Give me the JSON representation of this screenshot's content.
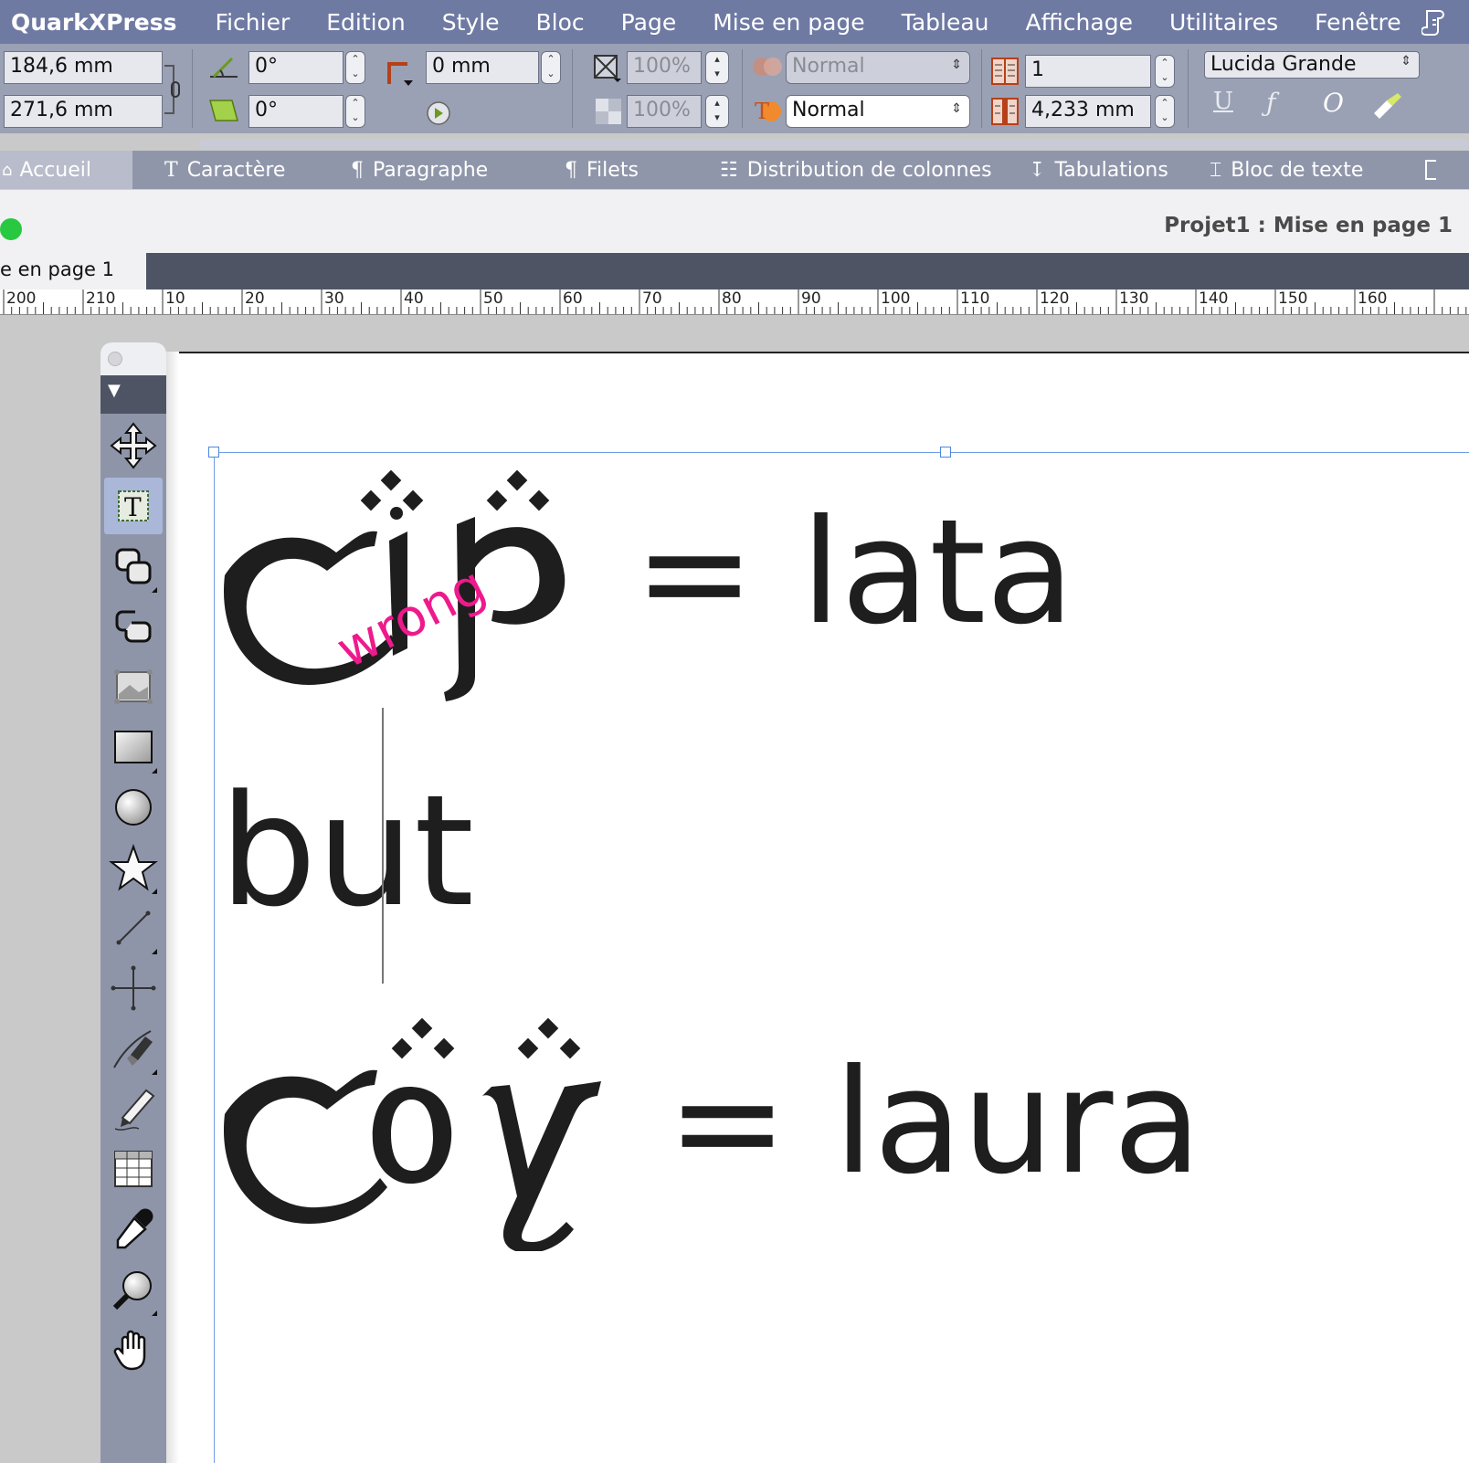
{
  "menubar": {
    "app_name": "QuarkXPress",
    "items": [
      "Fichier",
      "Edition",
      "Style",
      "Bloc",
      "Page",
      "Mise en page",
      "Tableau",
      "Affichage",
      "Utilitaires",
      "Fenêtre"
    ]
  },
  "measurements": {
    "width": "184,6 mm",
    "height": "271,6 mm",
    "angle": "0°",
    "skew": "0°",
    "corner_radius": "0 mm",
    "scale_x": "100%",
    "scale_y": "100%",
    "blend_mode_dim": "Normal",
    "blend_mode": "Normal",
    "columns": "1",
    "gutter": "4,233 mm",
    "font": "Lucida Grande"
  },
  "tabs": [
    "Accueil",
    "Caractère",
    "Paragraphe",
    "Filets",
    "Distribution de colonnes",
    "Tabulations",
    "Bloc de texte"
  ],
  "window": {
    "title": "Projet1 : Mise en page 1",
    "layout_tab": "e en page 1"
  },
  "ruler": {
    "labels": [
      "200",
      "210",
      "10",
      "20",
      "30",
      "40",
      "50",
      "60",
      "70",
      "80",
      "90",
      "100",
      "110",
      "120",
      "130",
      "140",
      "150",
      "160"
    ]
  },
  "document": {
    "line1_equals": "= lata",
    "annotation": "wrong",
    "line2": "but",
    "line3_equals": "= laura",
    "annotation_color": "#ee1a8c"
  },
  "tools": [
    "item-tool",
    "text-content-tool",
    "linking-tool",
    "unlinking-tool",
    "picture-content-tool",
    "rectangle-box-tool",
    "oval-box-tool",
    "star-box-tool",
    "line-tool",
    "orthogonal-line-tool",
    "bezier-pen-tool",
    "freehand-tool",
    "table-tool",
    "eyedropper-tool",
    "zoom-tool",
    "pan-tool"
  ],
  "colors": {
    "menubar": "#6f7aa3",
    "toolbar": "#9aa1b4",
    "selection": "#6f9ce6"
  }
}
